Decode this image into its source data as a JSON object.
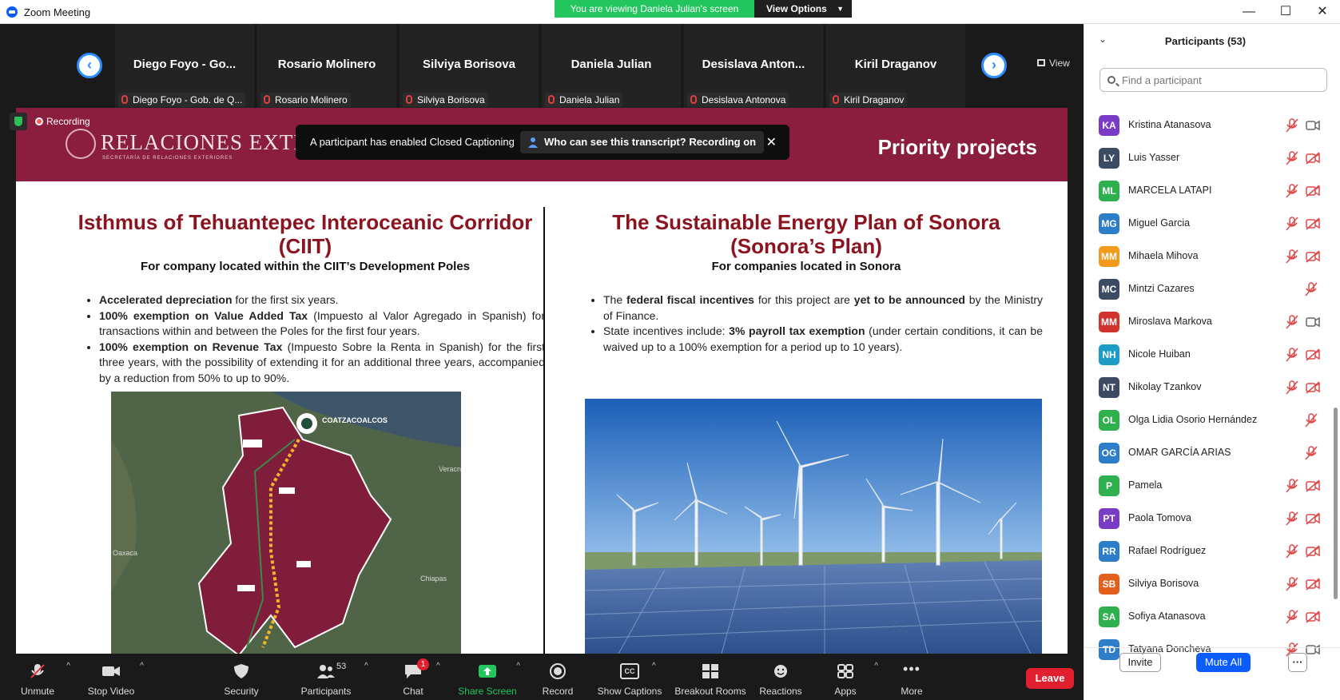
{
  "window": {
    "title": "Zoom Meeting",
    "minimize": "—",
    "maximize": "☐",
    "close": "✕"
  },
  "share_bar": {
    "viewing_text": "You are viewing Daniela Julian's screen",
    "view_options": "View Options"
  },
  "gallery": {
    "view_label": "View",
    "tiles": [
      {
        "name": "Diego Foyo - Go...",
        "label": "Diego Foyo - Gob. de Q..."
      },
      {
        "name": "Rosario Molinero",
        "label": "Rosario Molinero"
      },
      {
        "name": "Silviya Borisova",
        "label": "Silviya Borisova"
      },
      {
        "name": "Daniela Julian",
        "label": "Daniela Julian"
      },
      {
        "name": "Desislava Anton...",
        "label": "Desislava Antonova"
      },
      {
        "name": "Kiril Draganov",
        "label": "Kiril Draganov"
      }
    ]
  },
  "recording": {
    "label": "Recording"
  },
  "caption_notice": {
    "message": "A participant has enabled Closed Captioning",
    "who_label": "Who can see this transcript? Recording on",
    "close": "✕"
  },
  "slide": {
    "logo_text": "RELACIONES EXTERIORES",
    "logo_sub": "SECRETARÍA DE RELACIONES EXTERIORES",
    "header_title": "Priority projects",
    "left": {
      "title": "Isthmus of Tehuantepec Interoceanic Corridor (CIIT)",
      "subtitle": "For company located within the CIIT’s Development Poles",
      "bullets": [
        {
          "bold": "Accelerated depreciation",
          "rest": " for the first six years."
        },
        {
          "bold": "100% exemption on Value Added Tax",
          "rest": " (Impuesto al Valor Agregado in Spanish) for transactions within and between the Poles for the first four years."
        },
        {
          "bold": "100% exemption on Revenue Tax",
          "rest": " (Impuesto Sobre la Renta in Spanish) for the first three years, with the possibility of extending it for an additional three years, accompanied by a reduction from 50% to up to 90%."
        }
      ],
      "map_labels": {
        "city": "COATZACOALCOS",
        "west": "Oaxaca",
        "east": "Chiapas",
        "north": "Veracruz"
      }
    },
    "right": {
      "title": "The Sustainable Energy Plan of Sonora (Sonora’s Plan)",
      "subtitle": "For companies located in Sonora",
      "b1_pre": "The ",
      "b1_bold1": "federal fiscal incentives",
      "b1_mid": " for this project are ",
      "b1_bold2": "yet to be announced",
      "b1_post": " by the Ministry of Finance.",
      "b2_pre": "State incentives include: ",
      "b2_bold": "3% payroll tax exemption",
      "b2_post": " (under certain conditions, it can be waived up to a 100% exemption for a period up to 10 years)."
    }
  },
  "toolbar": {
    "unmute": "Unmute",
    "stop_video": "Stop Video",
    "security": "Security",
    "participants": "Participants",
    "participants_count": "53",
    "chat": "Chat",
    "chat_badge": "1",
    "share_screen": "Share Screen",
    "record": "Record",
    "show_captions": "Show Captions",
    "cc_glyph": "CC",
    "breakout_rooms": "Breakout Rooms",
    "reactions": "Reactions",
    "apps": "Apps",
    "more": "More",
    "leave": "Leave"
  },
  "participants_panel": {
    "title": "Participants (53)",
    "search_placeholder": "Find a participant",
    "people": [
      {
        "initials": "KA",
        "name": "Kristina Atanasova",
        "color": "#7a3cc7",
        "video": "on"
      },
      {
        "initials": "LY",
        "name": "Luis Yasser",
        "color": "#3d4a63",
        "video": "off"
      },
      {
        "initials": "ML",
        "name": "MARCELA LATAPI",
        "color": "#2fb04f",
        "video": "off"
      },
      {
        "initials": "MG",
        "name": "Miguel Garcia",
        "color": "#2e7dc9",
        "video": "off"
      },
      {
        "initials": "MM",
        "name": "Mihaela Mihova",
        "color": "#f29b1b",
        "video": "off"
      },
      {
        "initials": "MC",
        "name": "Mintzi Cazares",
        "color": "#3d4a63",
        "video": "none"
      },
      {
        "initials": "MM",
        "name": "Miroslava Markova",
        "color": "#d2322d",
        "video": "on"
      },
      {
        "initials": "NH",
        "name": "Nicole Huiban",
        "color": "#1c9cc6",
        "video": "off"
      },
      {
        "initials": "NT",
        "name": "Nikolay Tzankov",
        "color": "#3d4a63",
        "video": "off"
      },
      {
        "initials": "OL",
        "name": "Olga Lidia Osorio Hernández",
        "color": "#2fb04f",
        "video": "none"
      },
      {
        "initials": "OG",
        "name": "OMAR GARCÍA ARIAS",
        "color": "#2e7dc9",
        "video": "none"
      },
      {
        "initials": "P",
        "name": "Pamela",
        "color": "#2fb04f",
        "video": "off"
      },
      {
        "initials": "PT",
        "name": "Paola Tomova",
        "color": "#7a3cc7",
        "video": "off"
      },
      {
        "initials": "RR",
        "name": "Rafael Rodríguez",
        "color": "#2e7dc9",
        "video": "off"
      },
      {
        "initials": "SB",
        "name": "Silviya Borisova",
        "color": "#e2601c",
        "video": "off"
      },
      {
        "initials": "SA",
        "name": "Sofiya Atanasova",
        "color": "#2fb04f",
        "video": "off"
      },
      {
        "initials": "TD",
        "name": "Tatyana Doncheva",
        "color": "#2e7dc9",
        "video": "on"
      }
    ],
    "invite": "Invite",
    "mute_all": "Mute All",
    "more": "···"
  }
}
